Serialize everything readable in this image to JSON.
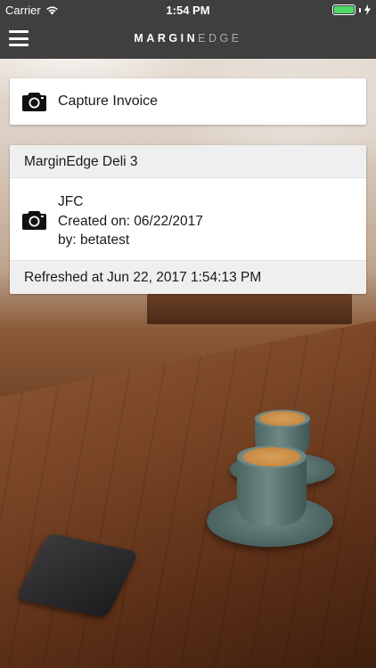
{
  "status_bar": {
    "carrier": "Carrier",
    "time": "1:54 PM",
    "wifi_icon": "wifi-icon",
    "battery_icon": "battery-icon",
    "battery_color": "#4cd964",
    "battery_level": 1.0
  },
  "nav": {
    "menu_icon": "hamburger-menu-icon",
    "logo_part1": "MARGIN",
    "logo_part2": "EDGE"
  },
  "capture": {
    "icon": "camera-icon",
    "label": "Capture Invoice"
  },
  "store": {
    "name": "MarginEdge Deli 3",
    "invoices": [
      {
        "icon": "camera-icon",
        "vendor": "JFC",
        "created": "Created on: 06/22/2017",
        "by": "by: betatest"
      }
    ],
    "refreshed": "Refreshed at Jun 22, 2017 1:54:13 PM"
  },
  "colors": {
    "nav_background": "#3f3f3f",
    "card_header": "#efefef"
  }
}
